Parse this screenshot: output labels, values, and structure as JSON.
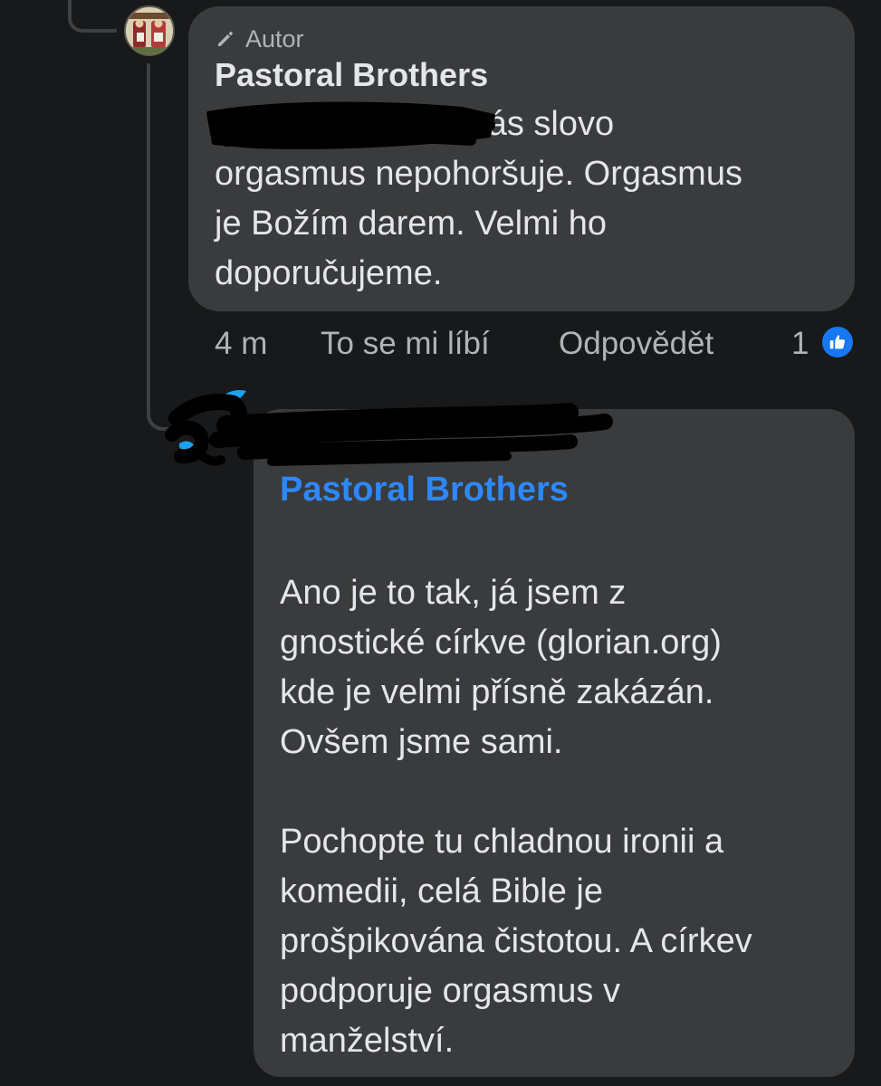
{
  "comment": {
    "badge_label": "Autor",
    "author": "Pastoral Brothers",
    "mention_fragment": "a",
    "text_lines": "nás slovo\norgasmus nepohoršuje. Orgasmus\nje Božím darem. Velmi ho\ndoporučujeme.",
    "time": "4 m",
    "like_action": "To se mi líbí",
    "reply_action": "Odpovědět",
    "reaction_count": "1"
  },
  "reply": {
    "mention": "Pastoral Brothers",
    "text": "Ano je to tak, já jsem z\ngnostické církve (glorian.org)\nkde je velmi přísně zakázán.\nOvšem jsme sami.\n\nPochopte tu chladnou ironii a\nkomedii, celá Bible je\nprošpikována čistotou. A církev\npodporuje orgasmus v\nmanželství."
  },
  "colors": {
    "background": "#18191a",
    "bubble": "#3a3b3c",
    "text": "#e4e6eb",
    "secondary_text": "#b0b3b8",
    "mention": "#2d88ff",
    "like_badge": "#1877f2",
    "redaction": "#000000"
  },
  "icons": {
    "badge": "pencil-icon",
    "reaction": "thumbs-up-icon"
  }
}
